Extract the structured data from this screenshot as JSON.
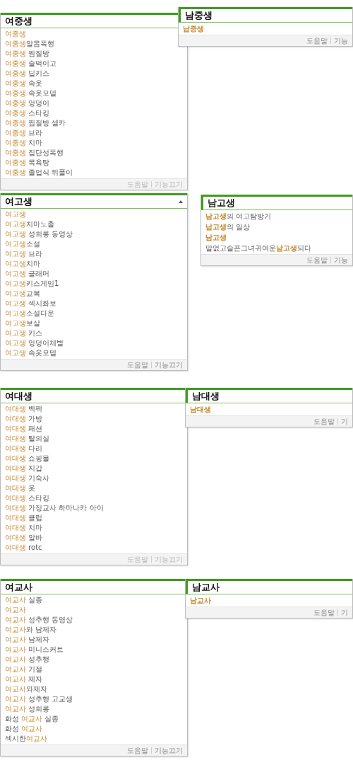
{
  "rows": [
    {
      "left": {
        "query": "여중생",
        "show_arrow": false,
        "footer_faded": true,
        "footer": [
          "도움말",
          "기능끄기"
        ],
        "suggestions": [
          [
            {
              "text": "여중생",
              "highlight": true
            }
          ],
          [
            {
              "text": "여중생",
              "highlight": true
            },
            {
              "text": "알몸폭행",
              "highlight": false
            }
          ],
          [
            {
              "text": "여중생",
              "highlight": true
            },
            {
              "text": " 찜질방",
              "highlight": false
            }
          ],
          [
            {
              "text": "여중생",
              "highlight": true
            },
            {
              "text": " 술먹이고",
              "highlight": false
            }
          ],
          [
            {
              "text": "여중생",
              "highlight": true
            },
            {
              "text": " 딥키스",
              "highlight": false
            }
          ],
          [
            {
              "text": "여중생",
              "highlight": true
            },
            {
              "text": " 속옷",
              "highlight": false
            }
          ],
          [
            {
              "text": "여중생",
              "highlight": true
            },
            {
              "text": " 속옷모델",
              "highlight": false
            }
          ],
          [
            {
              "text": "여중생",
              "highlight": true
            },
            {
              "text": " 엉덩이",
              "highlight": false
            }
          ],
          [
            {
              "text": "여중생",
              "highlight": true
            },
            {
              "text": " 스타킹",
              "highlight": false
            }
          ],
          [
            {
              "text": "여중생",
              "highlight": true
            },
            {
              "text": " 찜질방 셀카",
              "highlight": false
            }
          ],
          [
            {
              "text": "여중생",
              "highlight": true
            },
            {
              "text": " 브라",
              "highlight": false
            }
          ],
          [
            {
              "text": "여중생",
              "highlight": true
            },
            {
              "text": " 치마",
              "highlight": false
            }
          ],
          [
            {
              "text": "여중생",
              "highlight": true
            },
            {
              "text": " 집단성폭행",
              "highlight": false
            }
          ],
          [
            {
              "text": "여중생",
              "highlight": true
            },
            {
              "text": " 목욕탕",
              "highlight": false
            }
          ],
          [
            {
              "text": "여중생",
              "highlight": true
            },
            {
              "text": " 졸업식 뒤풀이",
              "highlight": false
            }
          ]
        ]
      },
      "right": {
        "query": "남중생",
        "footer": [
          "도움말",
          "기능"
        ],
        "suggestions": [
          [
            {
              "text": "남중생",
              "highlight": true
            }
          ]
        ]
      }
    },
    {
      "left": {
        "query": "여고생",
        "show_arrow": true,
        "footer_faded": false,
        "footer": [
          "도움말",
          "기능끄기"
        ],
        "suggestions": [
          [
            {
              "text": "여고생",
              "highlight": true
            }
          ],
          [
            {
              "text": "여고생",
              "highlight": true
            },
            {
              "text": "치마노출",
              "highlight": false
            }
          ],
          [
            {
              "text": "여고생",
              "highlight": true
            },
            {
              "text": " 성희롱 동영상",
              "highlight": false
            }
          ],
          [
            {
              "text": "여고생",
              "highlight": true
            },
            {
              "text": "소설",
              "highlight": false
            }
          ],
          [
            {
              "text": "여고생",
              "highlight": true
            },
            {
              "text": " 브라",
              "highlight": false
            }
          ],
          [
            {
              "text": "여고생",
              "highlight": true
            },
            {
              "text": "치마",
              "highlight": false
            }
          ],
          [
            {
              "text": "여고생",
              "highlight": true
            },
            {
              "text": " 글래머",
              "highlight": false
            }
          ],
          [
            {
              "text": "여고생",
              "highlight": true
            },
            {
              "text": "키스게임1",
              "highlight": false
            }
          ],
          [
            {
              "text": "여고생",
              "highlight": true
            },
            {
              "text": "교복",
              "highlight": false
            }
          ],
          [
            {
              "text": "여고생",
              "highlight": true
            },
            {
              "text": " 섹시화보",
              "highlight": false
            }
          ],
          [
            {
              "text": "여고생",
              "highlight": true
            },
            {
              "text": "소설다운",
              "highlight": false
            }
          ],
          [
            {
              "text": "여고생",
              "highlight": true
            },
            {
              "text": "보살",
              "highlight": false
            }
          ],
          [
            {
              "text": "여고생",
              "highlight": true
            },
            {
              "text": " 키스",
              "highlight": false
            }
          ],
          [
            {
              "text": "여고생",
              "highlight": true
            },
            {
              "text": " 엉덩이체벌",
              "highlight": false
            }
          ],
          [
            {
              "text": "여고생",
              "highlight": true
            },
            {
              "text": " 속옷모델",
              "highlight": false
            }
          ]
        ]
      },
      "right": {
        "query": "남고생",
        "footer": [
          "도움말",
          "기능"
        ],
        "suggestions": [
          [
            {
              "text": "남고생",
              "highlight": true
            },
            {
              "text": "의 여고탐방기",
              "highlight": false
            }
          ],
          [
            {
              "text": "남고생",
              "highlight": true
            },
            {
              "text": "의 일상",
              "highlight": false
            }
          ],
          [
            {
              "text": "남고생",
              "highlight": true
            }
          ],
          [
            {
              "text": "말없고슬픈그녀귀여운",
              "highlight": false
            },
            {
              "text": "남고생",
              "highlight": true
            },
            {
              "text": "되다",
              "highlight": false
            }
          ]
        ]
      }
    },
    {
      "left": {
        "query": "여대생",
        "show_arrow": false,
        "footer_faded": true,
        "footer": [
          "도움말",
          "기능끄기"
        ],
        "suggestions": [
          [
            {
              "text": "여대생",
              "highlight": true
            },
            {
              "text": " 백팩",
              "highlight": false
            }
          ],
          [
            {
              "text": "여대생",
              "highlight": true
            },
            {
              "text": " 가방",
              "highlight": false
            }
          ],
          [
            {
              "text": "여대생",
              "highlight": true
            },
            {
              "text": " 패션",
              "highlight": false
            }
          ],
          [
            {
              "text": "여대생",
              "highlight": true
            },
            {
              "text": " 탈의실",
              "highlight": false
            }
          ],
          [
            {
              "text": "여대생",
              "highlight": true
            },
            {
              "text": " 다리",
              "highlight": false
            }
          ],
          [
            {
              "text": "여대생",
              "highlight": true
            },
            {
              "text": " 쇼핑몰",
              "highlight": false
            }
          ],
          [
            {
              "text": "여대생",
              "highlight": true
            },
            {
              "text": " 지갑",
              "highlight": false
            }
          ],
          [
            {
              "text": "여대생",
              "highlight": true
            },
            {
              "text": " 기숙사",
              "highlight": false
            }
          ],
          [
            {
              "text": "여대생",
              "highlight": true
            },
            {
              "text": " 옷",
              "highlight": false
            }
          ],
          [
            {
              "text": "여대생",
              "highlight": true
            },
            {
              "text": " 스타킹",
              "highlight": false
            }
          ],
          [
            {
              "text": "여대생",
              "highlight": true
            },
            {
              "text": " 가정교사 하마나카 아이",
              "highlight": false
            }
          ],
          [
            {
              "text": "여대생",
              "highlight": true
            },
            {
              "text": " 클럽",
              "highlight": false
            }
          ],
          [
            {
              "text": "여대생",
              "highlight": true
            },
            {
              "text": " 치마",
              "highlight": false
            }
          ],
          [
            {
              "text": "여대생",
              "highlight": true
            },
            {
              "text": " 알바",
              "highlight": false
            }
          ],
          [
            {
              "text": "여대생",
              "highlight": true
            },
            {
              "text": " rotc",
              "highlight": false
            }
          ]
        ]
      },
      "right": {
        "query": "남대생",
        "footer": [
          "도움말",
          "기"
        ],
        "suggestions": [
          [
            {
              "text": "남대생",
              "highlight": true
            }
          ]
        ]
      }
    },
    {
      "left": {
        "query": "여교사",
        "show_arrow": false,
        "footer_faded": false,
        "footer": [
          "도움말",
          "기능끄기"
        ],
        "suggestions": [
          [
            {
              "text": "여교사",
              "highlight": true
            },
            {
              "text": " 실종",
              "highlight": false
            }
          ],
          [
            {
              "text": "여교사",
              "highlight": true
            }
          ],
          [
            {
              "text": "여교사",
              "highlight": true
            },
            {
              "text": " 성추행 동영상",
              "highlight": false
            }
          ],
          [
            {
              "text": "여교사",
              "highlight": true
            },
            {
              "text": "와 남제자",
              "highlight": false
            }
          ],
          [
            {
              "text": "여교사",
              "highlight": true
            },
            {
              "text": " 남제자",
              "highlight": false
            }
          ],
          [
            {
              "text": "여교사",
              "highlight": true
            },
            {
              "text": " 미니스커트",
              "highlight": false
            }
          ],
          [
            {
              "text": "여교사",
              "highlight": true
            },
            {
              "text": " 성추행",
              "highlight": false
            }
          ],
          [
            {
              "text": "여교사",
              "highlight": true
            },
            {
              "text": " 기절",
              "highlight": false
            }
          ],
          [
            {
              "text": "여교사",
              "highlight": true
            },
            {
              "text": " 제자",
              "highlight": false
            }
          ],
          [
            {
              "text": "여교사",
              "highlight": true
            },
            {
              "text": "와제자",
              "highlight": false
            }
          ],
          [
            {
              "text": "여교사",
              "highlight": true
            },
            {
              "text": " 성추행 고교생",
              "highlight": false
            }
          ],
          [
            {
              "text": "여교사",
              "highlight": true
            },
            {
              "text": " 성희롱",
              "highlight": false
            }
          ],
          [
            {
              "text": "화성 ",
              "highlight": false
            },
            {
              "text": "여교사",
              "highlight": true
            },
            {
              "text": " 실종",
              "highlight": false
            }
          ],
          [
            {
              "text": "화성 ",
              "highlight": false
            },
            {
              "text": "여교사",
              "highlight": true
            }
          ],
          [
            {
              "text": "섹시한",
              "highlight": false
            },
            {
              "text": "여교사",
              "highlight": true
            }
          ]
        ]
      },
      "right": {
        "query": "남교사",
        "footer": [
          "도움말",
          "기"
        ],
        "suggestions": [
          [
            {
              "text": "남교사",
              "highlight": true
            }
          ]
        ]
      }
    }
  ]
}
